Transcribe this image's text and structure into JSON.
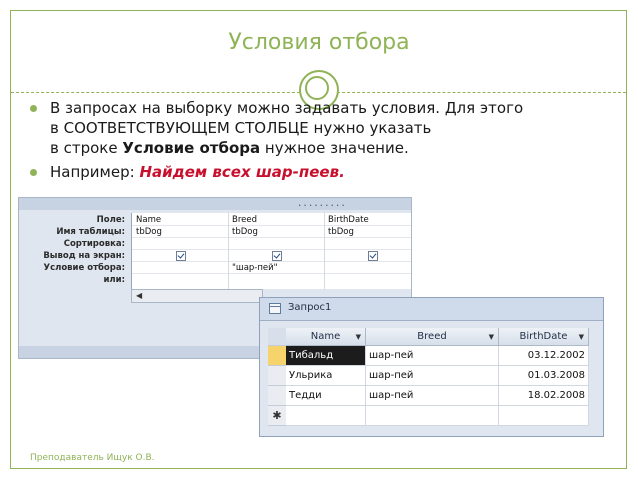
{
  "slide": {
    "title": "Условия отбора",
    "bullet1": {
      "line1": "В запросах на выборку можно задавать условия. Для этого",
      "line2": "в СООТВЕТСТВУЮЩЕМ СТОЛБЦЕ нужно указать",
      "line3_pre": "в строке ",
      "line3_bold": "Условие отбора",
      "line3_post": " нужное значение."
    },
    "bullet2": {
      "pre": "Например: ",
      "emph": "Найдем всех шар-пеев."
    },
    "footer": "Преподаватель Ищук О.В.",
    "accent_color": "#8fb356",
    "emphasis_color": "#c8102e"
  },
  "query_design": {
    "row_labels": [
      "Поле:",
      "Имя таблицы:",
      "Сортировка:",
      "Вывод на экран:",
      "Условие отбора:",
      "или:"
    ],
    "columns": [
      {
        "field": "Name",
        "table": "tbDog",
        "show": true,
        "criteria": ""
      },
      {
        "field": "Breed",
        "table": "tbDog",
        "show": true,
        "criteria": "\"шар-пей\""
      },
      {
        "field": "BirthDate",
        "table": "tbDog",
        "show": true,
        "criteria": ""
      }
    ]
  },
  "datasheet": {
    "title": "Запрос1",
    "headers": [
      "Name",
      "Breed",
      "BirthDate"
    ],
    "rows": [
      {
        "name": "Тибальд",
        "breed": "шар-пей",
        "birthdate": "03.12.2002"
      },
      {
        "name": "Ульрика",
        "breed": "шар-пей",
        "birthdate": "01.03.2008"
      },
      {
        "name": "Тедди",
        "breed": "шар-пей",
        "birthdate": "18.02.2008"
      }
    ],
    "new_row_marker": "✱"
  }
}
